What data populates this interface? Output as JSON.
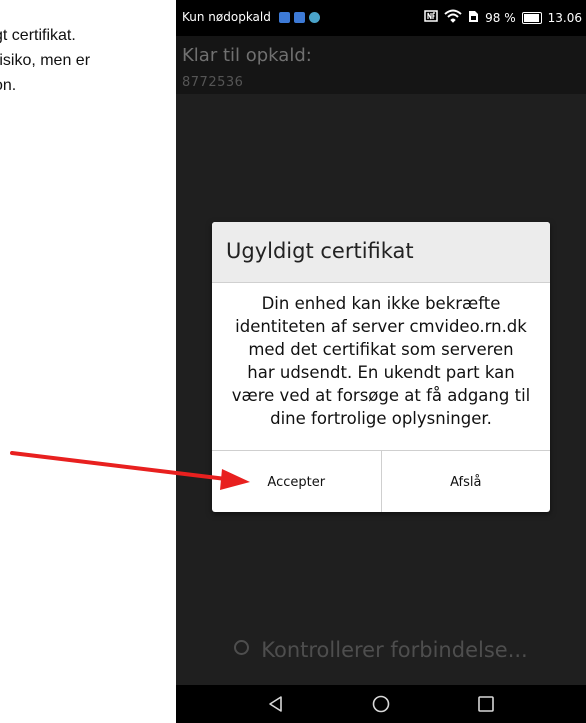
{
  "document": {
    "lines": [
      "gt certifikat.",
      "risiko, men er",
      "on."
    ]
  },
  "status_bar": {
    "carrier": "Kun nødopkald",
    "battery_text": "98 %",
    "battery_level": 0.98,
    "time": "13.06"
  },
  "call": {
    "status": "Klar til opkald:",
    "number": "8772536"
  },
  "dialog": {
    "title": "Ugyldigt certifikat",
    "message_lines": [
      "Din enhed kan ikke bekræfte",
      "identiteten af server cmvideo.rn.dk",
      "med det certifikat som serveren",
      "har udsendt. En ukendt part kan",
      "være ved at forsøge at få adgang til",
      "dine fortrolige oplysninger."
    ],
    "accept_label": "Accepter",
    "decline_label": "Afslå"
  },
  "progress": {
    "text": "Kontrollerer forbindelse..."
  },
  "colors": {
    "annotation_arrow": "#e8201f",
    "status_icon_blue": "#3d7ad6",
    "status_icon_teal": "#4aa3c9"
  },
  "icons": {
    "status_left": [
      "email-icon",
      "message-icon",
      "app-icon"
    ],
    "status_right": [
      "nfc-icon",
      "wifi-icon",
      "sim-icon",
      "battery-icon"
    ],
    "navigation": [
      "back-icon",
      "home-icon",
      "recents-icon"
    ]
  }
}
